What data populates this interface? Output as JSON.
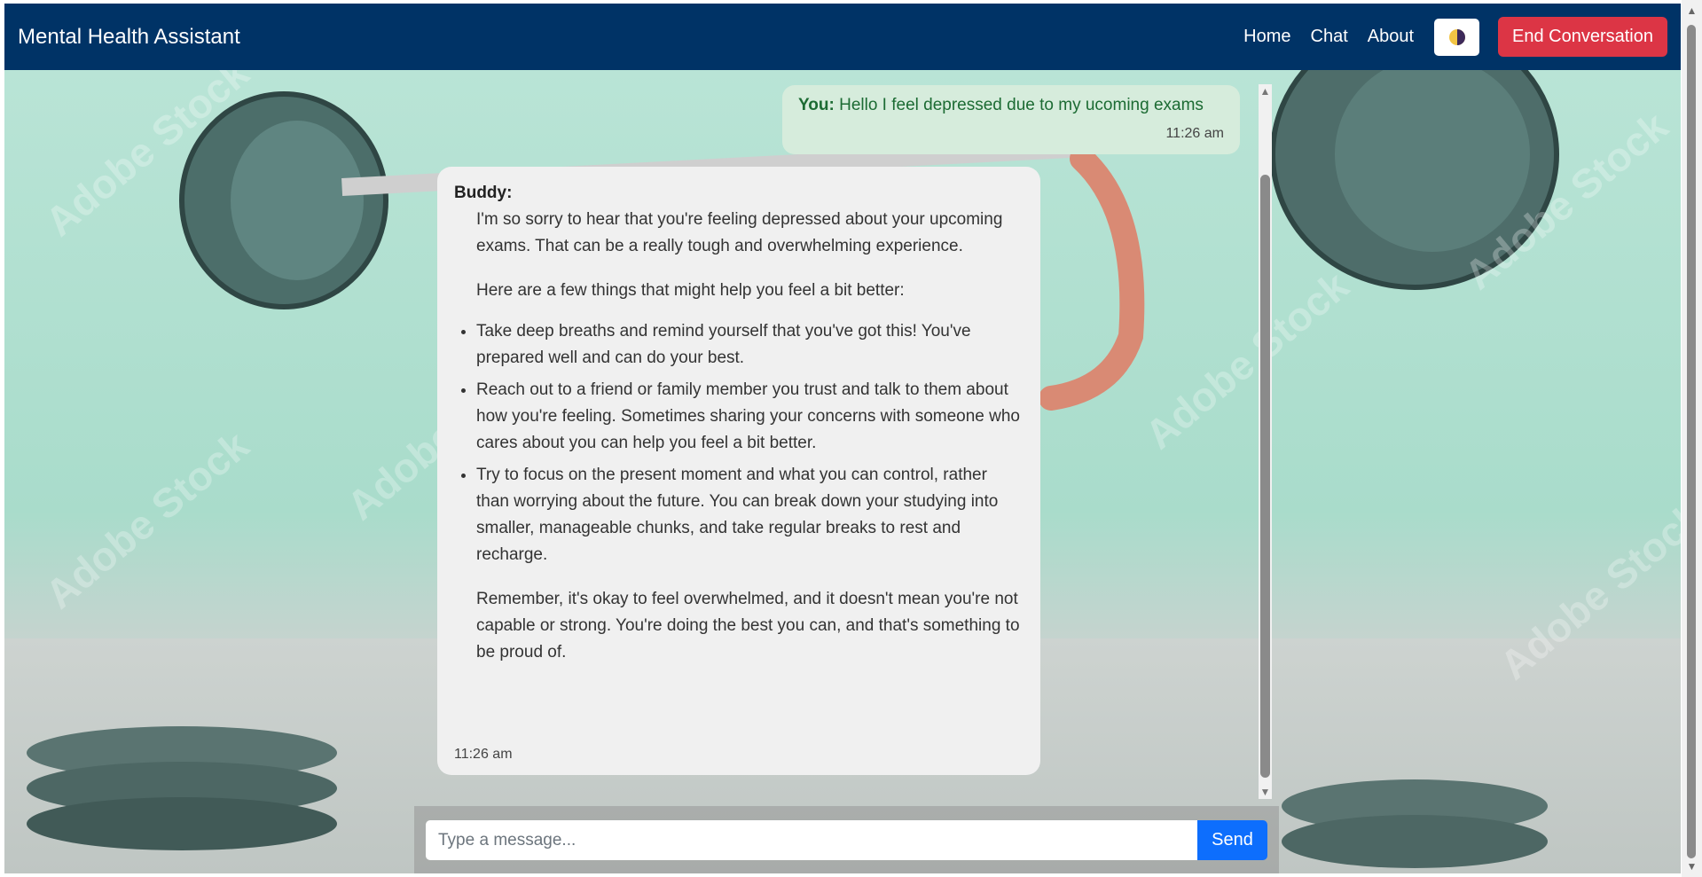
{
  "navbar": {
    "brand": "Mental Health Assistant",
    "links": [
      "Home",
      "Chat",
      "About"
    ],
    "theme_toggle_icon": "half-moon-icon",
    "end_button": "End Conversation"
  },
  "colors": {
    "navbar_bg": "#003366",
    "end_button_bg": "#dc3545",
    "send_button_bg": "#0d6efd",
    "user_bubble_bg": "#d6ecdc",
    "bot_bubble_bg": "#f0f0f0"
  },
  "background": {
    "watermark": "Adobe Stock"
  },
  "messages": {
    "user": {
      "sender": "You:",
      "text": "Hello I feel depressed due to my ucoming exams",
      "time": "11:26 am"
    },
    "bot": {
      "sender": "Buddy:",
      "intro": "I'm so sorry to hear that you're feeling depressed about your upcoming exams. That can be a really tough and overwhelming experience.",
      "lead": "Here are a few things that might help you feel a bit better:",
      "tips": [
        "Take deep breaths and remind yourself that you've got this! You've prepared well and can do your best.",
        "Reach out to a friend or family member you trust and talk to them about how you're feeling. Sometimes sharing your concerns with someone who cares about you can help you feel a bit better.",
        "Try to focus on the present moment and what you can control, rather than worrying about the future. You can break down your studying into smaller, manageable chunks, and take regular breaks to rest and recharge."
      ],
      "closing": "Remember, it's okay to feel overwhelmed, and it doesn't mean you're not capable or strong. You're doing the best you can, and that's something to be proud of.",
      "time": "11:26 am"
    }
  },
  "composer": {
    "placeholder": "Type a message...",
    "send_label": "Send"
  }
}
